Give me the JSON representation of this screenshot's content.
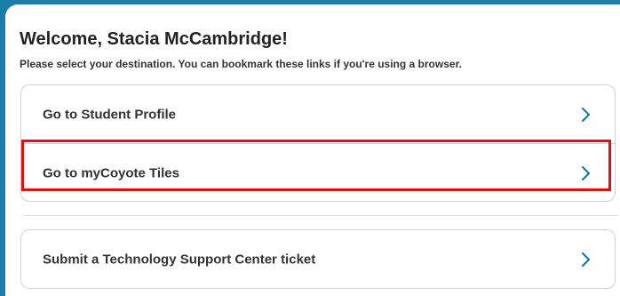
{
  "header": {
    "welcome": "Welcome, Stacia McCambridge!",
    "subtitle": "Please select your destination. You can bookmark these links if you're using a browser."
  },
  "destinations": [
    {
      "label": "Go to Student Profile",
      "icon": "chevron-right-icon",
      "highlighted": false
    },
    {
      "label": "Go to myCoyote Tiles",
      "icon": "chevron-right-icon",
      "highlighted": true
    },
    {
      "label": "Submit a Technology Support Center ticket",
      "icon": "chevron-right-icon",
      "highlighted": false
    }
  ],
  "colors": {
    "background": "#1a7fa6",
    "panel": "#ffffff",
    "chevron": "#1b6fa8",
    "highlight_border": "#e01010",
    "card_border": "#d2d2d2",
    "text": "#333333"
  }
}
